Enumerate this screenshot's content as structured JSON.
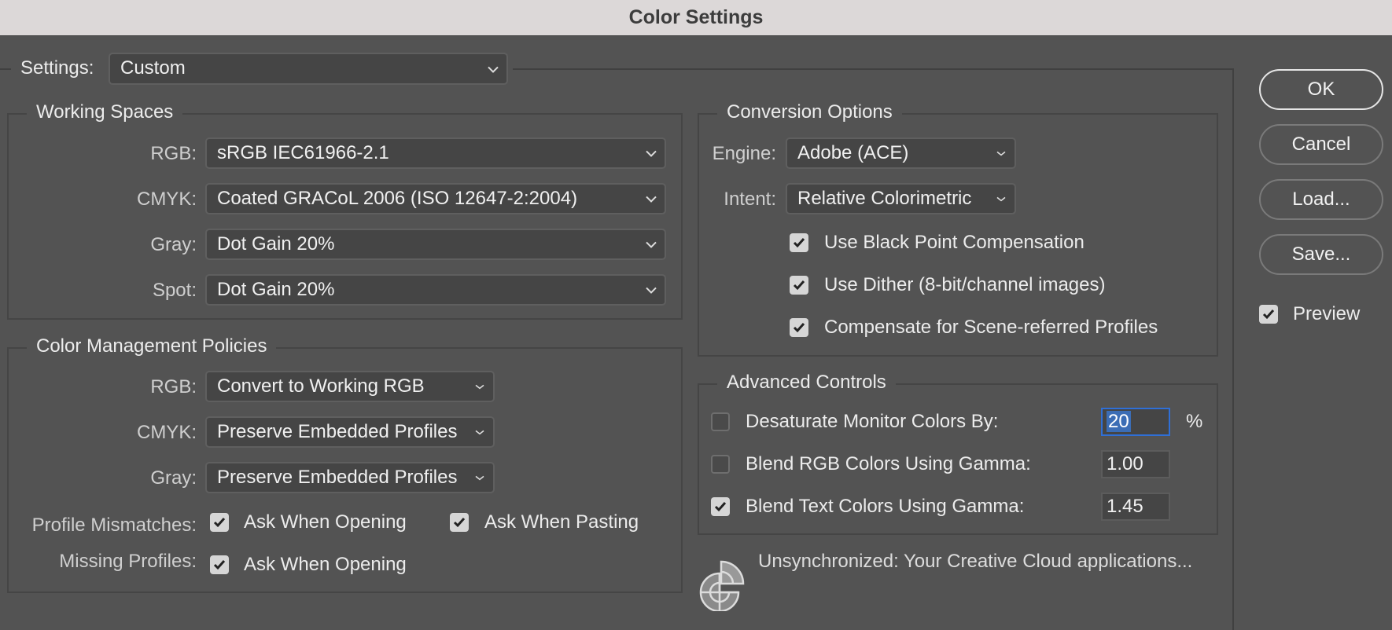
{
  "window": {
    "title": "Color Settings"
  },
  "settings": {
    "label": "Settings:",
    "value": "Custom"
  },
  "working_spaces": {
    "title": "Working Spaces",
    "rows": [
      {
        "label": "RGB:",
        "value": "sRGB IEC61966-2.1"
      },
      {
        "label": "CMYK:",
        "value": "Coated GRACoL 2006 (ISO 12647-2:2004)"
      },
      {
        "label": "Gray:",
        "value": "Dot Gain 20%"
      },
      {
        "label": "Spot:",
        "value": "Dot Gain 20%"
      }
    ]
  },
  "policies": {
    "title": "Color Management Policies",
    "rows": [
      {
        "label": "RGB:",
        "value": "Convert to Working RGB"
      },
      {
        "label": "CMYK:",
        "value": "Preserve Embedded Profiles"
      },
      {
        "label": "Gray:",
        "value": "Preserve Embedded Profiles"
      }
    ],
    "profile_mismatches": {
      "label": "Profile Mismatches:",
      "ask_opening": {
        "label": "Ask When Opening",
        "checked": true
      },
      "ask_pasting": {
        "label": "Ask When Pasting",
        "checked": true
      }
    },
    "missing_profiles": {
      "label": "Missing Profiles:",
      "ask_opening": {
        "label": "Ask When Opening",
        "checked": true
      }
    }
  },
  "conversion": {
    "title": "Conversion Options",
    "engine": {
      "label": "Engine:",
      "value": "Adobe (ACE)"
    },
    "intent": {
      "label": "Intent:",
      "value": "Relative Colorimetric"
    },
    "options": [
      {
        "label": "Use Black Point Compensation",
        "checked": true
      },
      {
        "label": "Use Dither (8-bit/channel images)",
        "checked": true
      },
      {
        "label": "Compensate for Scene-referred Profiles",
        "checked": true
      }
    ]
  },
  "advanced": {
    "title": "Advanced Controls",
    "rows": [
      {
        "label": "Desaturate Monitor Colors By:",
        "checked": false,
        "value": "20",
        "unit": "%"
      },
      {
        "label": "Blend RGB Colors Using Gamma:",
        "checked": false,
        "value": "1.00"
      },
      {
        "label": "Blend Text Colors Using Gamma:",
        "checked": true,
        "value": "1.45"
      }
    ]
  },
  "sync": {
    "message": "Unsynchronized: Your Creative Cloud applications...",
    "icon": "color-sync-icon"
  },
  "buttons": {
    "ok": "OK",
    "cancel": "Cancel",
    "load": "Load...",
    "save": "Save..."
  },
  "preview": {
    "label": "Preview",
    "checked": true
  },
  "colors": {
    "background": "#535353",
    "titlebar": "#dcd8d8",
    "focus": "#2f6fd6",
    "selection": "#3b6db5"
  }
}
